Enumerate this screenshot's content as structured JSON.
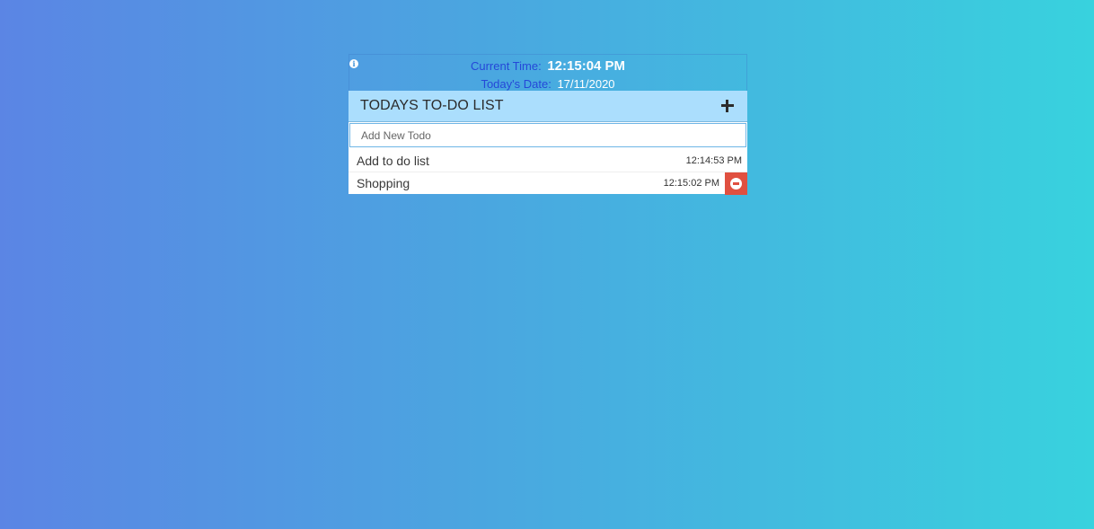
{
  "clock": {
    "time_label": "Current Time:",
    "time_value": "12:15:04 PM",
    "date_label": "Today's Date:",
    "date_value": "17/11/2020"
  },
  "header": {
    "title": "TODAYS TO-DO LIST"
  },
  "input": {
    "placeholder": "Add New Todo",
    "value": ""
  },
  "todos": [
    {
      "text": "Add to do list",
      "time": "12:14:53 PM",
      "hovered": false
    },
    {
      "text": "Shopping",
      "time": "12:15:02 PM",
      "hovered": true
    }
  ],
  "colors": {
    "header_bg": "#abdefd",
    "delete_bg": "#e05040",
    "label_blue": "#2548d8"
  },
  "icons": {
    "info": "info-icon",
    "add": "plus-icon",
    "delete": "minus-circle-icon"
  }
}
